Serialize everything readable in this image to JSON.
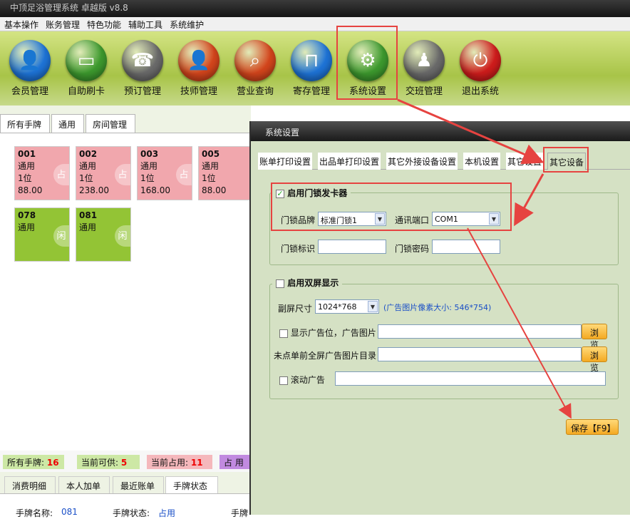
{
  "app": {
    "title": "中顶足浴管理系统 卓越版 v8.8"
  },
  "menu": [
    "基本操作",
    "账务管理",
    "特色功能",
    "辅助工具",
    "系统维护"
  ],
  "toolbar": [
    {
      "label": "会员管理",
      "icon": "member-icon",
      "color": "#1e74d8",
      "glyph": "👤"
    },
    {
      "label": "自助刷卡",
      "icon": "card-icon",
      "color": "#3d9a2e",
      "glyph": "▭"
    },
    {
      "label": "预订管理",
      "icon": "phone-icon",
      "color": "#6b6b6b",
      "glyph": "☎"
    },
    {
      "label": "技师管理",
      "icon": "technician-icon",
      "color": "#d4451c",
      "glyph": "👤"
    },
    {
      "label": "营业查询",
      "icon": "search-icon",
      "color": "#d4451c",
      "glyph": "⌕"
    },
    {
      "label": "寄存管理",
      "icon": "bag-icon",
      "color": "#1e74d8",
      "glyph": "⊓"
    },
    {
      "label": "系统设置",
      "icon": "gear-icon",
      "color": "#3d9a2e",
      "glyph": "⚙"
    },
    {
      "label": "交班管理",
      "icon": "team-icon",
      "color": "#6b6b6b",
      "glyph": "♟"
    },
    {
      "label": "退出系统",
      "icon": "power-icon",
      "color": "#d01c1c",
      "glyph": "⏻"
    }
  ],
  "room_tabs": [
    "所有手牌",
    "通用",
    "房间管理"
  ],
  "cards": [
    {
      "id": "001",
      "type": "通用",
      "people": "1位",
      "amount": "88.00",
      "state": "占",
      "style": "pink"
    },
    {
      "id": "002",
      "type": "通用",
      "people": "1位",
      "amount": "238.00",
      "state": "占",
      "style": "pink"
    },
    {
      "id": "003",
      "type": "通用",
      "people": "1位",
      "amount": "168.00",
      "state": "占",
      "style": "pink"
    },
    {
      "id": "005",
      "type": "通用",
      "people": "1位",
      "amount": "88.00",
      "state": "",
      "style": "pink"
    },
    {
      "id": "078",
      "type": "通用",
      "people": "",
      "amount": "",
      "state": "闲",
      "style": "green"
    },
    {
      "id": "081",
      "type": "通用",
      "people": "",
      "amount": "",
      "state": "闲",
      "style": "green"
    }
  ],
  "status": {
    "all_label": "所有手牌:",
    "all": "16",
    "avail_label": "当前可供:",
    "avail": "5",
    "occ_label": "当前占用:",
    "occ": "11",
    "occ2": "占 用"
  },
  "bottom_tabs": [
    "消费明细",
    "本人加单",
    "最近账单",
    "手牌状态"
  ],
  "detail": {
    "name_label": "手牌名称:",
    "name": "081",
    "state_label": "手牌状态:",
    "state": "占用",
    "more": "手牌"
  },
  "dialog": {
    "title": "系统设置",
    "tabs": [
      "账单打印设置",
      "出品单打印设置",
      "其它外接设备设置",
      "本机设置",
      "其它设置",
      "其它设备"
    ],
    "lock_group": {
      "label": "启用门锁发卡器",
      "checked": "✓",
      "brand_label": "门锁品牌",
      "brand": "标准门锁1",
      "port_label": "通讯端口",
      "port": "COM1",
      "id_label": "门锁标识",
      "id": "",
      "pwd_label": "门锁密码",
      "pwd": ""
    },
    "dual_group": {
      "label": "启用双屏显示",
      "size_label": "副屏尺寸",
      "size": "1024*768",
      "size_hint": "(广告图片像素大小: 546*754)",
      "ad_label": "显示广告位，广告图片",
      "ad": "",
      "fullscreen_label": "未点单前全屏广告图片目录",
      "fullscreen": "",
      "browse": "浏览",
      "scroll_label": "滚动广告",
      "scroll": ""
    },
    "save": "保存【F9】"
  }
}
